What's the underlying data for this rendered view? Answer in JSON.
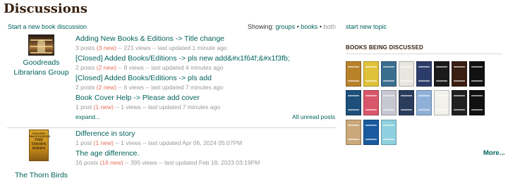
{
  "header": {
    "title": "Discussions",
    "start_discussion": "Start a new book discussion",
    "showing_label": "Showing:",
    "showing_options": [
      {
        "label": "groups",
        "active": true
      },
      {
        "label": "books",
        "active": true
      },
      {
        "label": "both",
        "active": false
      }
    ],
    "separator": "•",
    "start_topic": "start new topic"
  },
  "groups": [
    {
      "name": "Goodreads Librarians Group",
      "name_lines": [
        "Goodreads",
        "Librarians Group"
      ],
      "icon": "library-cover-image",
      "topics": [
        {
          "title": "Adding New Books & Editions -> Title change",
          "posts": "3 posts",
          "new": "(3 new)",
          "rest": "-- 221 views -- last updated   1 minute ago"
        },
        {
          "title": "[Closed] Added Books/Editions -> pls new add&#x1f64f;&#x1f3fb;",
          "posts": "2 posts",
          "new": "(2 new)",
          "rest": "-- 8 views -- last updated   4 minutes ago"
        },
        {
          "title": "[Closed] Added Books/Editions -> pls add",
          "posts": "2 posts",
          "new": "(2 new)",
          "rest": "-- 6 views -- last updated   7 minutes ago"
        },
        {
          "title": "Book Cover Help -> Please add cover",
          "posts": "1 post",
          "new": "(1 new)",
          "rest": "-- 1 views -- last updated   7 minutes ago"
        }
      ],
      "expand": "expand...",
      "all_unread": "All unread posts"
    },
    {
      "name": "The Thorn Birds",
      "name_lines": [
        "The Thorn Birds"
      ],
      "icon": "thorn-birds-cover-image",
      "cover_text": [
        "COLLEEN McCULLOUGH",
        "THE",
        "THORN",
        "BIRDS"
      ],
      "topics": [
        {
          "title": "Difference in story",
          "posts": "1 post",
          "new": "(1 new)",
          "rest": "-- 1 views -- last updated   Apr 06, 2024 05:07PM"
        },
        {
          "title": "The age difference.",
          "posts": "16 posts",
          "new": "(16 new)",
          "rest": "-- 395 views -- last updated   Feb 18, 2023 03:19PM"
        }
      ]
    }
  ],
  "books_panel": {
    "heading": "BOOKS BEING DISCUSSED",
    "rows": [
      [
        "#b8822b",
        "#e0c23a",
        "#3a6e8f",
        "#e8e6df",
        "#2c3c6a",
        "#1a1a1a",
        "#3a1e12",
        "#111111"
      ],
      [
        "#1d4f7a",
        "#d9566a",
        "#c7c7d1",
        "#2a3d5c",
        "#8fb0d8",
        "#f3f1ec",
        "#202020",
        "#111111"
      ],
      [
        "#caa87a",
        "#1a5a9e",
        "#8fd0e0"
      ]
    ],
    "more": "More..."
  }
}
